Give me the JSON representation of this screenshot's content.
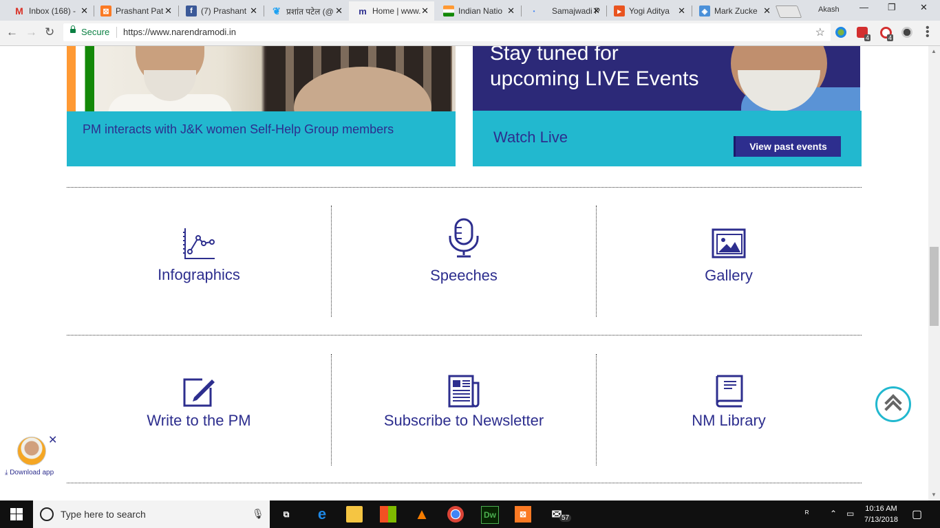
{
  "browser": {
    "tabs": [
      {
        "label": "Inbox (168) -",
        "icon": "gmail-icon",
        "color": "#ffffff"
      },
      {
        "label": "Prashant Pat",
        "icon": "xampp-icon",
        "color": "#fb7a24"
      },
      {
        "label": "(7) Prashant",
        "icon": "facebook-icon",
        "color": "#3b5998"
      },
      {
        "label": "प्रशांत पटेल (@",
        "icon": "twitter-icon",
        "color": "#1da1f2"
      },
      {
        "label": "Home | www.",
        "icon": "narendramodi-icon",
        "color": "#2d2e8e"
      },
      {
        "label": "Indian Natio",
        "icon": "congress-icon",
        "color": "#138808"
      },
      {
        "label": "Samajwadi P",
        "icon": "loading-icon",
        "color": "#4285f4"
      },
      {
        "label": "Yogi Aditya",
        "icon": "yogi-icon",
        "color": "#e95420"
      },
      {
        "label": "Mark Zucke",
        "icon": "wiki-icon",
        "color": "#4a90d9"
      }
    ],
    "user": "Akash",
    "secure_label": "Secure",
    "url": "https://www.narendramodi.in",
    "extension_badges": [
      "4",
      "4"
    ]
  },
  "page": {
    "card_left": {
      "caption": "PM interacts with J&K women Self-Help Group members"
    },
    "card_right": {
      "banner_line1": "Stay tuned for",
      "banner_line2": "upcoming LIVE Events",
      "watch_live": "Watch Live",
      "past_events_button": "View past events"
    },
    "features_row1": [
      "Infographics",
      "Speeches",
      "Gallery"
    ],
    "features_row2": [
      "Write to the PM",
      "Subscribe to Newsletter",
      "NM Library"
    ],
    "download_app": "Download app",
    "accent_color": "#2d2e8e",
    "teal_color": "#22b8cf"
  },
  "taskbar": {
    "search_placeholder": "Type here to search",
    "mail_badge": "57",
    "time": "10:16 AM",
    "date": "7/13/2018"
  }
}
